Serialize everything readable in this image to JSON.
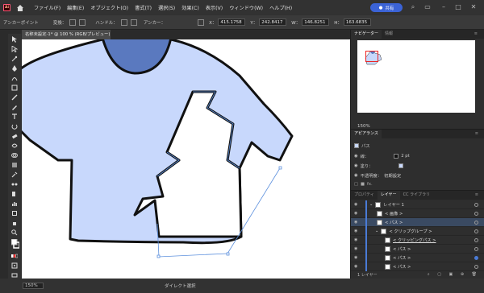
{
  "app": {
    "logo": "Ai"
  },
  "menu": [
    "ファイル(F)",
    "編集(E)",
    "オブジェクト(O)",
    "書式(T)",
    "選択(S)",
    "効果(C)",
    "表示(V)",
    "ウィンドウ(W)",
    "ヘルプ(H)"
  ],
  "share_button": "共有",
  "control": {
    "context_label": "アンカーポイント",
    "convert_label": "変換：",
    "handle_label": "ハンドル：",
    "anchor_label": "アンカー：",
    "x_label": "X：",
    "x_value": "415.1758",
    "y_label": "Y：",
    "y_value": "242.8417",
    "w_label": "W：",
    "w_value": "146.8251",
    "h_label": "H：",
    "h_value": "163.6835"
  },
  "document_tab": "名称未設定-1* @ 100 % (RGB/プレビュー)",
  "status": {
    "zoom": "150%",
    "mode": "ダイレクト選択"
  },
  "navigator": {
    "tabs": [
      "ナビゲーター",
      "情報"
    ],
    "zoom": "150%"
  },
  "appearance": {
    "tab": "アピアランス",
    "object": "パス",
    "stroke_label": "線：",
    "stroke_value": "2 pt",
    "fill_label": "塗り：",
    "opacity_label": "不透明度：",
    "opacity_value": "初期設定"
  },
  "layers": {
    "tabs": [
      "プロパティ",
      "レイヤー",
      "CC ライブラリ"
    ],
    "rows": [
      "レイヤー 1",
      "< 画像 >",
      "< パス >",
      "< クリップグループ >",
      "< クリッピングパス >",
      "< パス >",
      "< パス >",
      "< パス >"
    ],
    "footer": "1 レイヤー"
  },
  "colors": {
    "shirt_fill": "#c8d8fc",
    "collar_fill": "#5a79bf",
    "accent": "#3b63d6",
    "selection": "#5b8fdd"
  }
}
